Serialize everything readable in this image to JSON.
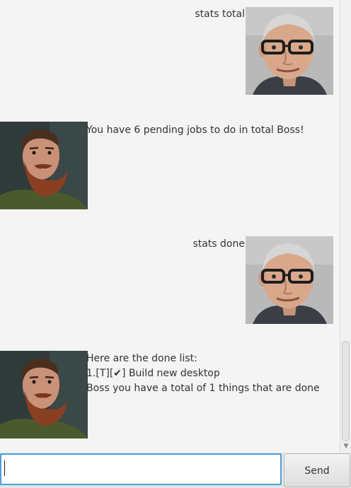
{
  "messages": [
    {
      "sender": "user",
      "text": "stats total"
    },
    {
      "sender": "bot",
      "text": "You have 6 pending jobs to do in total Boss!"
    },
    {
      "sender": "user",
      "text": "stats done"
    },
    {
      "sender": "bot",
      "lines": [
        "Here are the done list:",
        "1.[T][✔] Build new desktop",
        "Boss you have a total of 1 things that are done"
      ]
    }
  ],
  "input": {
    "value": "",
    "placeholder": ""
  },
  "send_button": {
    "label": "Send"
  },
  "colors": {
    "background": "#f4f4f4",
    "input_focus_border": "#4aa0d8",
    "text": "#333333"
  }
}
